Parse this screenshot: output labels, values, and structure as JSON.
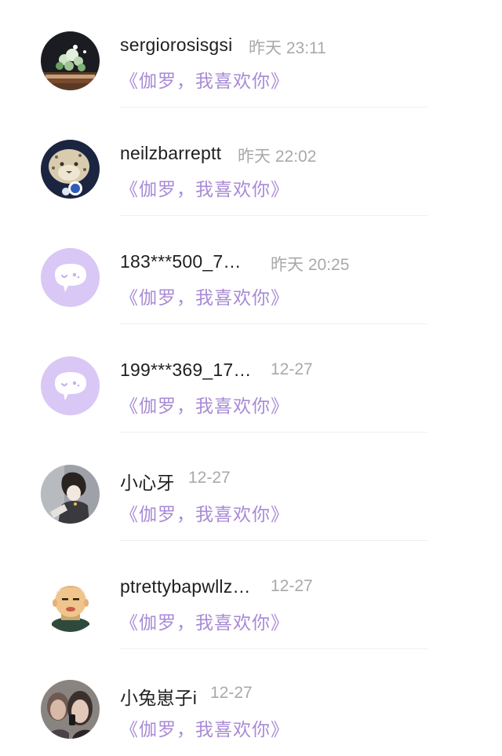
{
  "messages": [
    {
      "user": "sergiorosisgsi",
      "time": "昨天 23:11",
      "work": "《伽罗，我喜欢你》",
      "avatar": "flower-photo"
    },
    {
      "user": "neilzbarreptt",
      "time": "昨天 22:02",
      "work": "《伽罗，我喜欢你》",
      "avatar": "snow-leopard-photo"
    },
    {
      "user": "183***500_7…",
      "time": "昨天 20:25",
      "work": "《伽罗，我喜欢你》",
      "avatar": "default-chat-bubble"
    },
    {
      "user": "199***369_17…",
      "time": "12-27",
      "work": "《伽罗，我喜欢你》",
      "avatar": "default-chat-bubble"
    },
    {
      "user": "小心牙",
      "time": "12-27",
      "work": "《伽罗，我喜欢你》",
      "avatar": "anime-character-drawing"
    },
    {
      "user": "ptrettybapwllz…",
      "time": "12-27",
      "work": "《伽罗，我喜欢你》",
      "avatar": "cartoon-man-drawing"
    },
    {
      "user": "小兔崽子i",
      "time": "12-27",
      "work": "《伽罗，我喜欢你》",
      "avatar": "couple-photo"
    }
  ],
  "colors": {
    "work_title": "#a88ad6",
    "default_avatar_bg": "#d9c7f5",
    "timestamp": "#a9a9a9"
  }
}
